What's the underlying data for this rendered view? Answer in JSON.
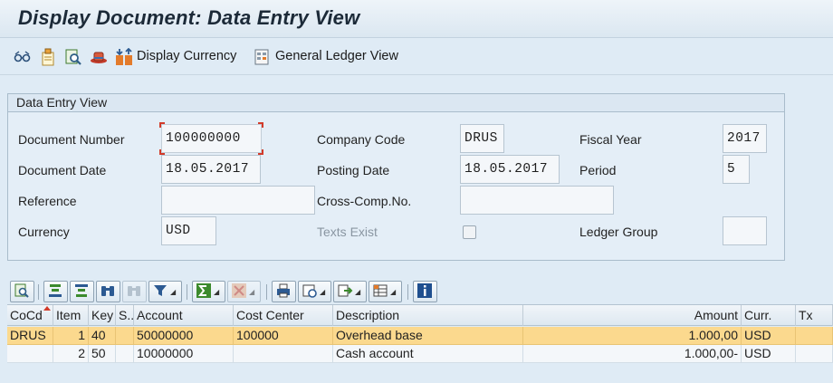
{
  "window": {
    "title": "Display Document: Data Entry View"
  },
  "toolbar": {
    "icons": [
      "glasses-icon",
      "edit-document-icon",
      "search-doc-icon",
      "hat-icon",
      "currency-icon",
      "ledger-icon"
    ],
    "display_currency_label": "Display Currency",
    "general_ledger_label": "General Ledger View"
  },
  "header_group": {
    "title": "Data Entry View",
    "document_number_label": "Document Number",
    "document_number": "100000000",
    "company_code_label": "Company Code",
    "company_code": "DRUS",
    "fiscal_year_label": "Fiscal Year",
    "fiscal_year": "2017",
    "document_date_label": "Document Date",
    "document_date": "18.05.2017",
    "posting_date_label": "Posting Date",
    "posting_date": "18.05.2017",
    "period_label": "Period",
    "period": "5",
    "reference_label": "Reference",
    "reference": "",
    "cross_comp_label": "Cross-Comp.No.",
    "cross_comp": "",
    "currency_label": "Currency",
    "currency": "USD",
    "texts_exist_label": "Texts Exist",
    "texts_exist_checked": false,
    "ledger_group_label": "Ledger Group",
    "ledger_group": ""
  },
  "grid": {
    "columns": [
      "CoCd",
      "Item",
      "Key",
      "S...",
      "Account",
      "Cost Center",
      "Description",
      "Amount",
      "Curr.",
      "Tx"
    ],
    "rows": [
      {
        "cocd": "DRUS",
        "item": "1",
        "key": "40",
        "s": "",
        "account": "50000000",
        "cost_center": "100000",
        "description": "Overhead base",
        "amount": "1.000,00",
        "curr": "USD",
        "tx": ""
      },
      {
        "cocd": "",
        "item": "2",
        "key": "50",
        "s": "",
        "account": "10000000",
        "cost_center": "",
        "description": "Cash account",
        "amount": "1.000,00-",
        "curr": "USD",
        "tx": ""
      }
    ],
    "selected_row": 0
  },
  "colors": {
    "background": "#dfebf5",
    "selected_row": "#fbd98e",
    "focus_corner": "#d23b2a"
  }
}
